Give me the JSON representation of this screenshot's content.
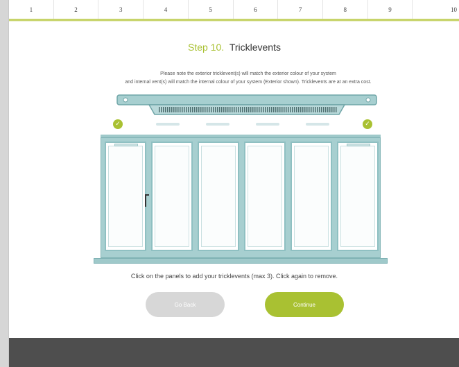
{
  "steps": [
    "1",
    "2",
    "3",
    "4",
    "5",
    "6",
    "7",
    "8",
    "9",
    "10"
  ],
  "title": {
    "number": "Step 10.",
    "text": "Tricklevents"
  },
  "description": {
    "line1": "Please note the exterior tricklevent(s) will match the exterior colour of your system",
    "line2": "and internal vent(s) will match the internal colour of your system (Exterior shown). Tricklevents are at an extra cost."
  },
  "indicators": [
    "check",
    "dash",
    "dash",
    "dash",
    "dash",
    "check"
  ],
  "check_glyph": "✓",
  "hint": "Click on the panels to add your tricklevents (max 3). Click again to remove.",
  "buttons": {
    "back": "Go Back",
    "continue": "Continue"
  },
  "colors": {
    "accent": "#a9c132",
    "frame": "#a7cfd0",
    "footer": "#4e4e4e"
  }
}
